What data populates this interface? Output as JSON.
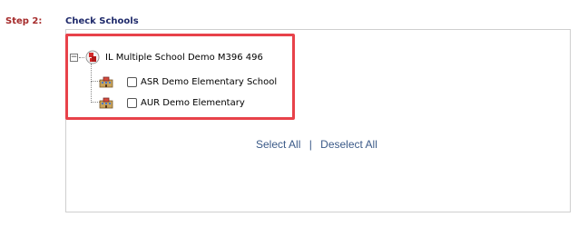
{
  "step": {
    "label": "Step 2:"
  },
  "section": {
    "title": "Check Schools"
  },
  "tree": {
    "root": {
      "label": "IL Multiple School Demo M396 496",
      "toggle": "−"
    },
    "schools": [
      {
        "label": "ASR Demo Elementary School",
        "checked": false
      },
      {
        "label": "AUR Demo Elementary",
        "checked": false
      }
    ]
  },
  "actions": {
    "select_all": "Select All",
    "separator": "|",
    "deselect_all": "Deselect All"
  },
  "colors": {
    "highlight": "#e8424a",
    "step": "#a52a2a",
    "title": "#1f2a6b",
    "link": "#3b5a88"
  }
}
